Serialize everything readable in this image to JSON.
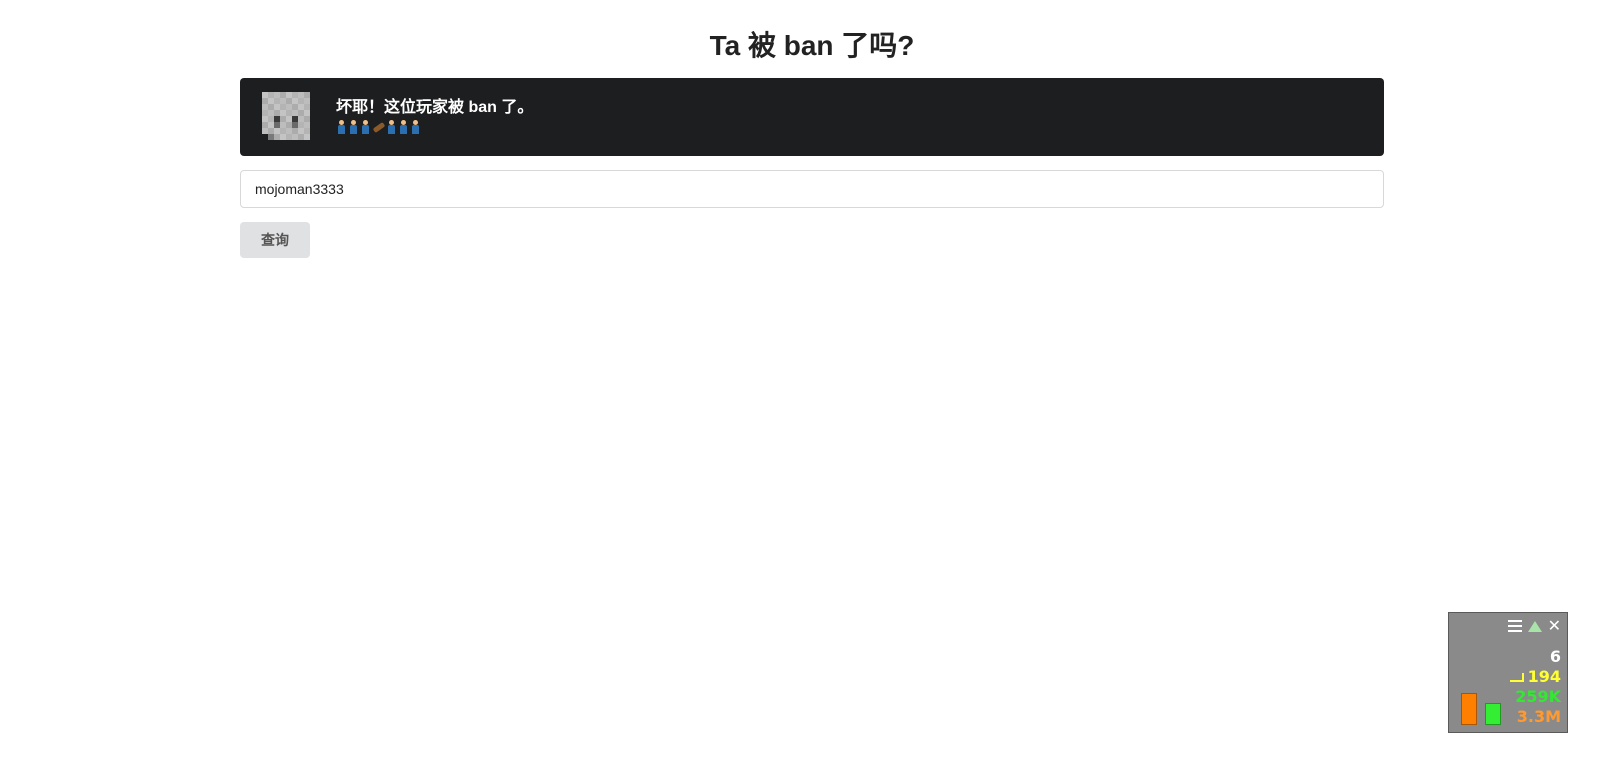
{
  "page": {
    "title": "Ta 被 ban 了吗?"
  },
  "result_banner": {
    "message": "坏耶！这位玩家被 ban 了。",
    "emoji_sequence": [
      "person",
      "person",
      "person",
      "coffin",
      "person",
      "person",
      "person"
    ],
    "background_color": "#1d1e20"
  },
  "search": {
    "value": "mojoman3333",
    "button_label": "查询"
  },
  "perf_widget": {
    "count": "6",
    "fps": "194",
    "memory": "259K",
    "dom": "3.3M",
    "icons": [
      "menu-icon",
      "collapse-up-icon",
      "close-icon"
    ],
    "colors": {
      "fps": "#ffff33",
      "memory": "#33e833",
      "dom": "#ff9a33"
    }
  }
}
